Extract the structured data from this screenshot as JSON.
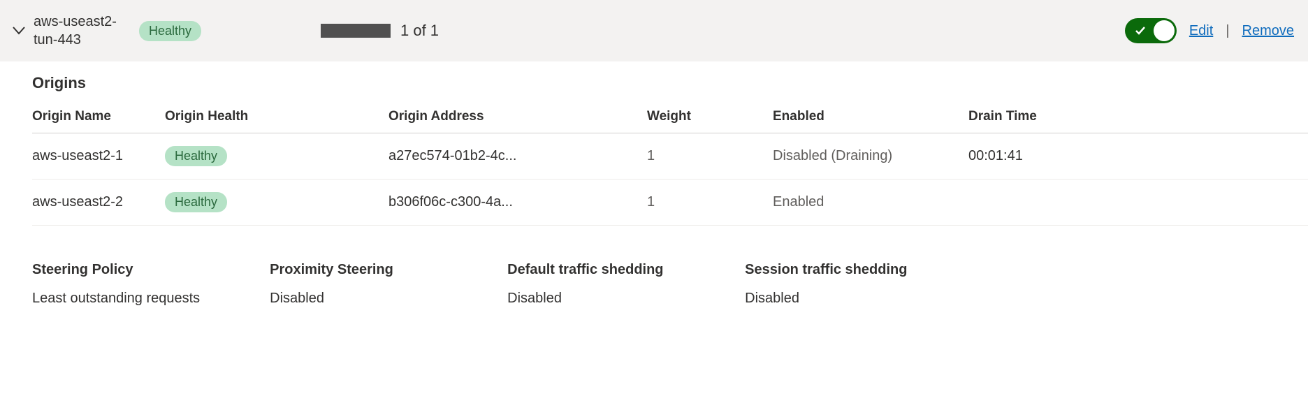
{
  "pool": {
    "name": "aws-useast2-tun-443",
    "health": "Healthy",
    "progress_text": "1 of 1",
    "enabled": true,
    "edit_label": "Edit",
    "remove_label": "Remove"
  },
  "origins_section_title": "Origins",
  "origins_headers": {
    "name": "Origin Name",
    "health": "Origin Health",
    "address": "Origin Address",
    "weight": "Weight",
    "enabled": "Enabled",
    "drain": "Drain Time"
  },
  "origins": [
    {
      "name": "aws-useast2-1",
      "health": "Healthy",
      "address": "a27ec574-01b2-4c...",
      "weight": "1",
      "enabled": "Disabled (Draining)",
      "drain": "00:01:41"
    },
    {
      "name": "aws-useast2-2",
      "health": "Healthy",
      "address": "b306f06c-c300-4a...",
      "weight": "1",
      "enabled": "Enabled",
      "drain": ""
    }
  ],
  "policies": [
    {
      "label": "Steering Policy",
      "value": "Least outstanding requests"
    },
    {
      "label": "Proximity Steering",
      "value": "Disabled"
    },
    {
      "label": "Default traffic shedding",
      "value": "Disabled"
    },
    {
      "label": "Session traffic shedding",
      "value": "Disabled"
    }
  ]
}
